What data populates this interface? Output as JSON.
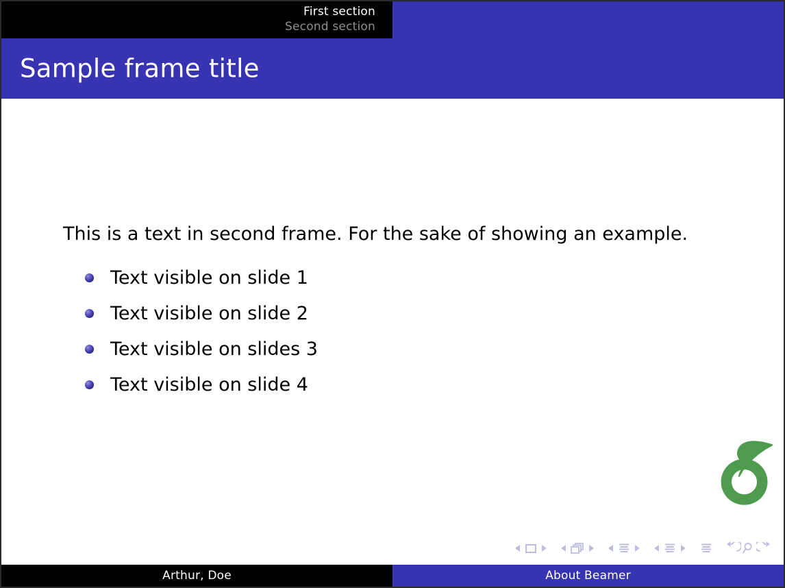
{
  "slide": {
    "colors": {
      "beamer_blue": "#3833B0",
      "headline_black": "#000000",
      "body_background": "#ffffff",
      "active_section_text": "#ffffff",
      "inactive_section_text": "#8e8e95",
      "bullet_ball": "#3d38a8",
      "logo_green": "#4E9A4E",
      "nav_symbol": "#bdbde0"
    },
    "headline": {
      "sections": [
        {
          "label": "First section",
          "state": "active"
        },
        {
          "label": "Second section",
          "state": "inactive"
        }
      ]
    },
    "frame_title": "Sample frame title",
    "body": {
      "intro_text": "This is a text in second frame.  For the sake of showing an example.",
      "items": [
        {
          "label": "Text visible on slide 1"
        },
        {
          "label": "Text visible on slide 2"
        },
        {
          "label": "Text visible on slides 3"
        },
        {
          "label": "Text visible on slide 4"
        }
      ]
    },
    "logo": {
      "name": "overleaf-logo"
    },
    "navigation_symbols": [
      {
        "name": "slide-backward",
        "icon": "triangle-left"
      },
      {
        "name": "slide-current",
        "icon": "square"
      },
      {
        "name": "slide-forward",
        "icon": "triangle-right"
      },
      {
        "name": "frame-backward",
        "icon": "triangle-left"
      },
      {
        "name": "frame-current",
        "icon": "stacked-squares"
      },
      {
        "name": "frame-forward",
        "icon": "triangle-right"
      },
      {
        "name": "subsection-backward",
        "icon": "triangle-left"
      },
      {
        "name": "subsection-current",
        "icon": "lines"
      },
      {
        "name": "subsection-forward",
        "icon": "triangle-right"
      },
      {
        "name": "section-backward",
        "icon": "triangle-left"
      },
      {
        "name": "section-current",
        "icon": "lines"
      },
      {
        "name": "section-forward",
        "icon": "triangle-right"
      },
      {
        "name": "presentation-overview",
        "icon": "lines"
      },
      {
        "name": "go-back",
        "icon": "arrow-counterclockwise"
      },
      {
        "name": "search",
        "icon": "magnifier"
      },
      {
        "name": "go-forward",
        "icon": "arrow-clockwise"
      }
    ],
    "footline": {
      "author": "Arthur, Doe",
      "title": "About Beamer"
    }
  }
}
